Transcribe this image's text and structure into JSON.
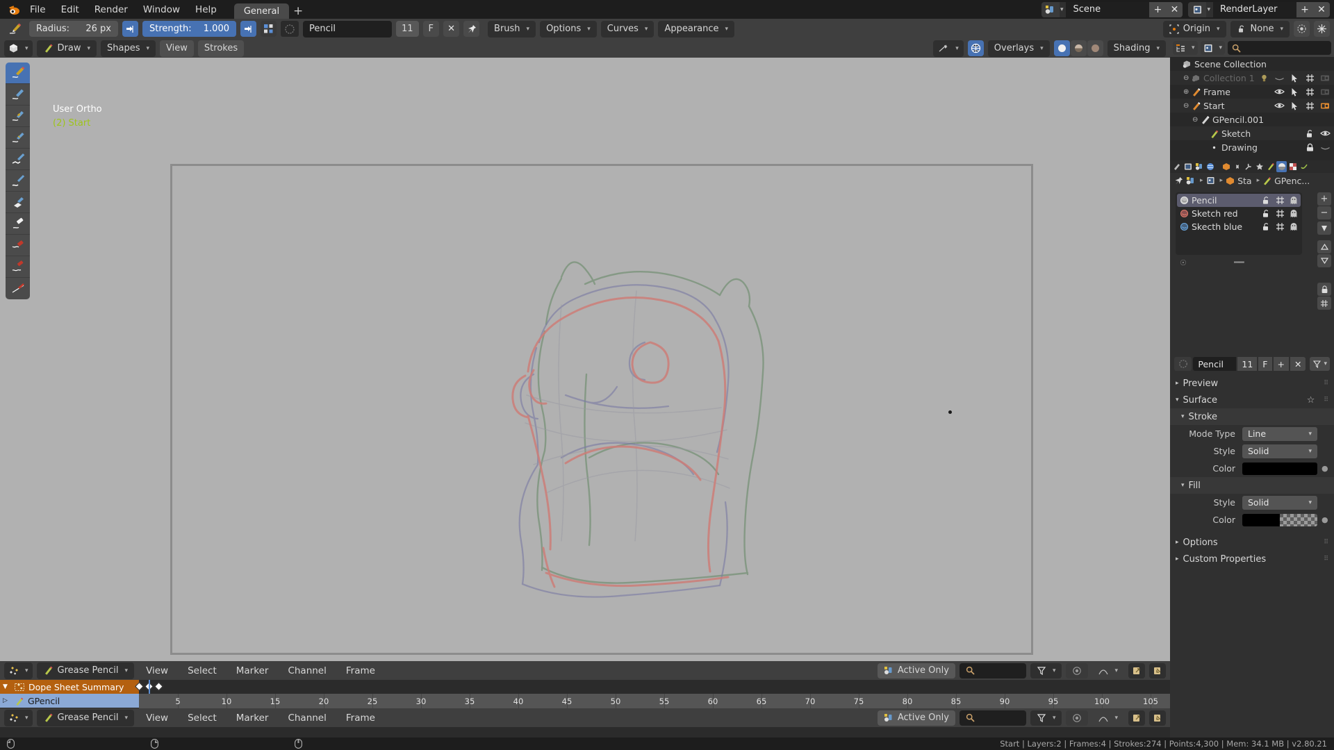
{
  "topbar": {
    "logo_icon": "blender-logo-icon",
    "menus": [
      "File",
      "Edit",
      "Render",
      "Window",
      "Help"
    ],
    "workspace_tab": "General",
    "add_workspace_label": "+",
    "scene": {
      "icon": "scene-icon",
      "name": "Scene",
      "add": "+",
      "remove": "✕"
    },
    "viewlayer": {
      "icon": "viewlayer-icon",
      "name": "RenderLayer",
      "add": "+",
      "remove": "✕"
    }
  },
  "toolsettings": {
    "brush_icon": "pencil-stroke-icon",
    "radius_label": "Radius:",
    "radius_value": "26 px",
    "radius_pressure_icon": "pressure-icon",
    "strength_label": "Strength:",
    "strength_value": "1.000",
    "strength_pressure_icon": "pressure-icon",
    "brush_preset_icon": "brush-presets-icon",
    "brush_swatch_icon": "brush-swatch-icon",
    "brush_name": "Pencil",
    "brush_users": "11",
    "brush_fake_user": "F",
    "brush_unlink": "✕",
    "brush_pin_icon": "pin-icon",
    "menus": [
      "Brush",
      "Options",
      "Curves",
      "Appearance"
    ],
    "pivot": {
      "icon": "pivot-origin-icon",
      "label": "Origin"
    },
    "snap": {
      "icon": "snap-lock-icon",
      "label": "None"
    },
    "proportional_icon": "proportional-edit-icon",
    "proportional_falloff_icon": "falloff-icon"
  },
  "viewport": {
    "editor_type_icon": "editor-3dview-icon",
    "mode": {
      "icon": "draw-mode-icon",
      "label": "Draw"
    },
    "menus_with_chevron": [
      "Shapes"
    ],
    "menus": [
      "View",
      "Strokes"
    ],
    "gizmo_icon": "gizmo-icon",
    "overlays": {
      "icon": "overlays-icon",
      "label": "Overlays"
    },
    "shading_modes": [
      "wireframe",
      "solid",
      "material",
      "rendered"
    ],
    "shading_label": "Shading",
    "header_text_line1": "User Ortho",
    "header_text_line2": "(2) Start",
    "header_text_color": "#9ec41a",
    "background_color": "#b1b1b1",
    "tools": [
      "draw-tool-icon",
      "fill-line-tool-icon",
      "erase-blur-tool-icon",
      "thickness-tool-icon",
      "strength-tool-icon",
      "randomize-tool-icon",
      "fill-tool-icon",
      "eraser-soft-tool-icon",
      "eraser-hard-tool-icon",
      "eraser-stroke-tool-icon",
      "cutter-tool-icon"
    ],
    "selected_tool_index": 0,
    "cursor_icon": "3d-cursor-icon",
    "object_dot_icon": "object-origin-dot-icon"
  },
  "outliner": {
    "display_mode_icon": "outliner-display-mode-icon",
    "filter_icon": "outliner-filter-icon",
    "search_icon": "search-icon",
    "search_value": "",
    "rows": [
      {
        "indent": 0,
        "icon": "scene-collection-icon",
        "label": "Scene Collection",
        "expander": "",
        "restrict": []
      },
      {
        "indent": 1,
        "icon": "collection-icon",
        "label": "Collection 1",
        "expander": "⊖",
        "dim": true,
        "restrict": [
          "light-icon",
          "hide-off-icon",
          "select-icon",
          "render-grid-icon",
          "camera-off-icon"
        ]
      },
      {
        "indent": 1,
        "icon": "gpencil-orange-icon",
        "label": "Frame",
        "expander": "⊕",
        "restrict": [
          "eye-icon",
          "select-icon",
          "render-grid-icon",
          "camera-off-icon"
        ]
      },
      {
        "indent": 1,
        "icon": "gpencil-orange-icon",
        "label": "Start",
        "expander": "⊖",
        "restrict": [
          "eye-icon",
          "select-icon",
          "render-grid-icon",
          "camera-icon"
        ]
      },
      {
        "indent": 2,
        "icon": "gpencil-data-icon",
        "label": "GPencil.001",
        "expander": "⊖",
        "restrict": []
      },
      {
        "indent": 3,
        "icon": "gpencil-layer-icon",
        "label": "Sketch",
        "expander": "",
        "restrict": [
          "unlock-icon",
          "eye-icon"
        ]
      },
      {
        "indent": 3,
        "icon": "dot-icon",
        "label": "Drawing",
        "expander": "",
        "restrict": [
          "lock-icon",
          "hide-off-icon"
        ]
      }
    ]
  },
  "properties": {
    "tabs": [
      "tool-icon",
      "render-icon",
      "output-icon",
      "viewlayer-icon",
      "scene-props-icon",
      "world-icon",
      "object-icon",
      "constraints-icon",
      "modifier-icon",
      "particles-icon",
      "gpencil-data-tab-icon",
      "material-icon",
      "texture-icon",
      "physics-icon"
    ],
    "selected_tab_icon": "material-icon",
    "breadcrumb": [
      {
        "icon": "pin-icon",
        "label": ""
      },
      {
        "icon": "scene-icon",
        "label": ""
      },
      {
        "icon": "viewlayer-icon",
        "label": ""
      },
      {
        "icon": "object-orange-icon",
        "label": "Sta"
      },
      {
        "icon": "gpencil-green-icon",
        "label": "GPenc..."
      }
    ]
  },
  "layers": {
    "items": [
      {
        "icon": "layer-dot-white-icon",
        "name": "Pencil",
        "selected": true,
        "icons": [
          "unlock-icon",
          "mask-grid-icon",
          "onion-ghost-icon"
        ]
      },
      {
        "icon": "layer-dot-red-icon",
        "name": "Sketch red",
        "selected": false,
        "icons": [
          "unlock-icon",
          "mask-grid-icon",
          "onion-ghost-icon"
        ]
      },
      {
        "icon": "layer-dot-blue-icon",
        "name": "Skecth blue",
        "selected": false,
        "icons": [
          "unlock-icon",
          "mask-grid-icon",
          "onion-ghost-icon"
        ]
      }
    ],
    "add_label": "+",
    "remove_label": "−",
    "specials_icon": "layer-specials-icon",
    "move_up_icon": "move-up-icon",
    "move_down_icon": "move-down-icon",
    "footer_add_icon": "add-small-icon",
    "footer_grip_icon": "grip-icon"
  },
  "material": {
    "preview_icon": "material-sphere-icon",
    "name": "Pencil",
    "users": "11",
    "fake_user": "F",
    "add": "+",
    "unlink": "✕",
    "specials_icon": "material-specials-icon",
    "panels": [
      {
        "name": "Preview",
        "open": false
      },
      {
        "name": "Surface",
        "open": true,
        "star_icon": "star-icon"
      }
    ],
    "stroke": {
      "title": "Stroke",
      "rows": [
        {
          "label": "Mode Type",
          "type": "enum",
          "value": "Line"
        },
        {
          "label": "Style",
          "type": "enum",
          "value": "Solid"
        },
        {
          "label": "Color",
          "type": "color",
          "value": "#000000"
        }
      ]
    },
    "fill": {
      "title": "Fill",
      "rows": [
        {
          "label": "Style",
          "type": "enum",
          "value": "Solid"
        },
        {
          "label": "Color",
          "type": "color",
          "value": "#000000",
          "alpha": true
        }
      ]
    },
    "extra_panels": [
      "Options",
      "Custom Properties"
    ]
  },
  "dopesheet": {
    "editor_icon": "dopesheet-icon",
    "mode": {
      "icon": "gpencil-green-icon",
      "label": "Grease Pencil"
    },
    "menus": [
      "View",
      "Select",
      "Marker",
      "Channel",
      "Frame"
    ],
    "active_only": {
      "icon": "scene-icon",
      "label": "Active Only"
    },
    "search_icon": "search-icon",
    "search_value": "",
    "filter_icon": "filter-icon",
    "proportional_icon": "proportional-icon",
    "falloff_icon": "falloff-icon",
    "copy_icon": "copy-keys-icon",
    "paste_icon": "paste-keys-icon",
    "channels": [
      {
        "icon": "dopesheet-summary-icon",
        "label": "Dope Sheet Summary",
        "type": "summary",
        "expander": "▼"
      },
      {
        "icon": "gpencil-green-icon",
        "label": "GPencil",
        "type": "gpencil",
        "expander": "▷"
      }
    ],
    "keyframes_summary": [
      1,
      2,
      3
    ],
    "current_frame": "2",
    "ruler_ticks": [
      5,
      10,
      15,
      20,
      25,
      30,
      35,
      40,
      45,
      50,
      55,
      60,
      65,
      70,
      75,
      80,
      85,
      90,
      95,
      100,
      105
    ],
    "frame_range_start": 1,
    "frame_range_end": 107
  },
  "statusbar": {
    "mouse_hints": [
      "select-mouse-icon",
      "context-mouse-icon"
    ],
    "info": "Start | Layers:2 | Frames:4 | Strokes:274 | Points:4,300 | Mem: 34.1 MB | v2.80.21"
  }
}
